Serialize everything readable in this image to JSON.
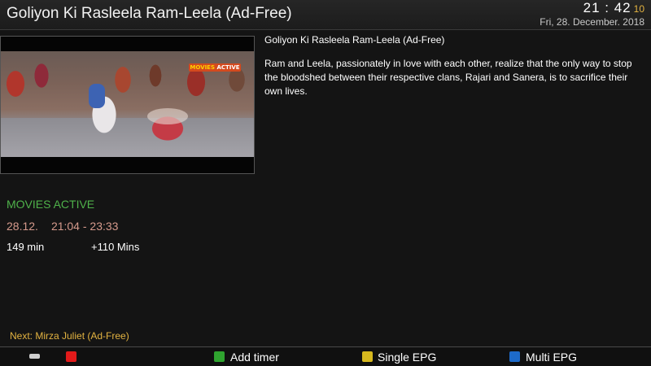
{
  "header": {
    "title": "Goliyon Ki Rasleela Ram-Leela (Ad-Free)",
    "time_hm": "21 : 42",
    "time_sec": "10",
    "date": "Fri, 28. December. 2018"
  },
  "preview": {
    "channel_logo_left": "MOVIES",
    "channel_logo_right": "ACTIVE"
  },
  "event": {
    "title": "Goliyon Ki Rasleela Ram-Leela (Ad-Free)",
    "description": "Ram and Leela, passionately in love with each other, realize that the only way to stop the bloodshed between their respective clans, Rajari and Sanera, is to sacrifice their own lives.",
    "channel": "MOVIES ACTIVE",
    "date": "28.12.",
    "time_range": "21:04 - 23:33",
    "duration": "149 min",
    "remaining": "+110 Mins",
    "next": "Next: Mirza Juliet (Ad-Free)"
  },
  "footer": {
    "keyboard_icon": "keyboard-icon",
    "red_label": "",
    "green_label": "Add timer",
    "yellow_label": "Single EPG",
    "blue_label": "Multi EPG"
  },
  "colors": {
    "red": "#e21a1a",
    "green": "#2fa32f",
    "yellow": "#d6b81e",
    "blue": "#1d6ac9",
    "channel_text": "#4fb24a",
    "time_text": "#d59a8c",
    "accent": "#e3b341"
  }
}
